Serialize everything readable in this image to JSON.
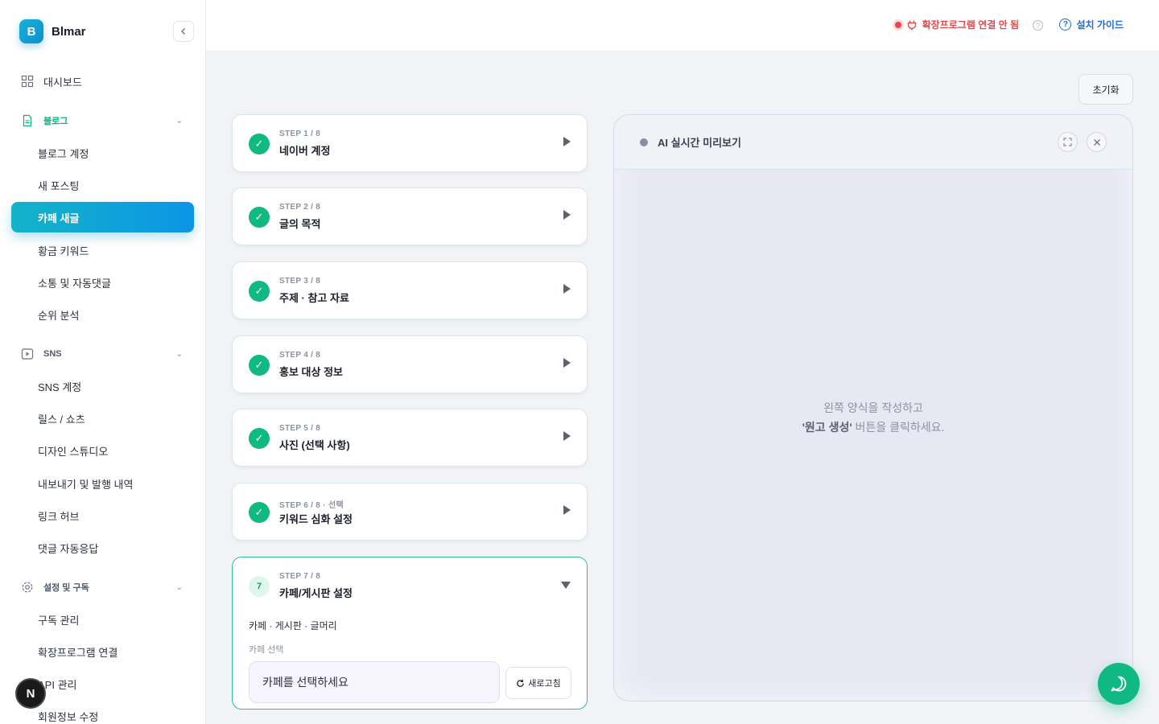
{
  "brand": {
    "logo_letter": "B",
    "name": "Blmar"
  },
  "sidebar": {
    "dashboard": "대시보드",
    "sections": [
      {
        "title": "블로그",
        "items": [
          "블로그 계정",
          "새 포스팅",
          "카페 새글",
          "황금 키워드",
          "소통 및 자동댓글",
          "순위 분석"
        ]
      },
      {
        "title": "SNS",
        "items": [
          "SNS 계정",
          "릴스 / 쇼츠",
          "디자인 스튜디오",
          "내보내기 및 발행 내역",
          "링크 허브",
          "댓글 자동응답"
        ]
      },
      {
        "title": "설정 및 구독",
        "items": [
          "구독 관리",
          "확장프로그램 연결",
          "API 관리",
          "회원정보 수정"
        ]
      }
    ],
    "active_item": "카페 새글",
    "floating_badge": "N"
  },
  "header": {
    "extension_status": "확장프로그램 연결 안 됨",
    "help_symbol": "?",
    "install_guide": "설치 가이드"
  },
  "toolbar": {
    "reset_label": "초기화"
  },
  "steps": [
    {
      "meta": "STEP 1 / 8",
      "title": "네이버 계정",
      "done": true
    },
    {
      "meta": "STEP 2 / 8",
      "title": "글의 목적",
      "done": true
    },
    {
      "meta": "STEP 3 / 8",
      "title": "주제 · 참고 자료",
      "done": true
    },
    {
      "meta": "STEP 4 / 8",
      "title": "홍보 대상 정보",
      "done": true
    },
    {
      "meta": "STEP 5 / 8",
      "title": "사진 (선택 사항)",
      "done": true
    },
    {
      "meta": "STEP 6 / 8 · 선택",
      "title": "키워드 심화 설정",
      "done": true
    }
  ],
  "current_step": {
    "number": "7",
    "meta": "STEP 7 / 8",
    "title": "카페/게시판 설정",
    "subtitle": "카페 · 게시판 · 글머리",
    "field_label": "카페 선택",
    "select_value": "카페를 선택하세요",
    "refresh_label": "새로고침"
  },
  "preview": {
    "title": "AI 실시간 미리보기",
    "message_line1": "왼쪽 양식을 작성하고",
    "message_bold": "'원고 생성'",
    "message_line2_rest": " 버튼을 클릭하세요."
  },
  "colors": {
    "accent": "#10b981",
    "brand": "#0e8ecf",
    "error": "#e5484d",
    "link": "#1a6fd6"
  }
}
